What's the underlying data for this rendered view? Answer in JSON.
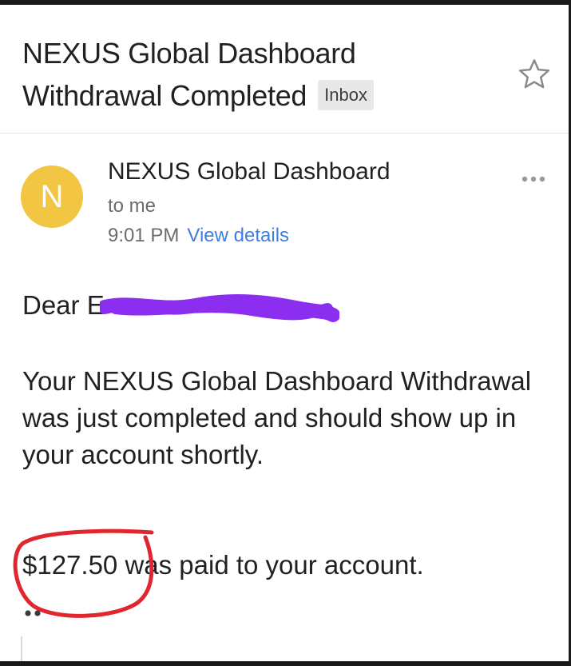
{
  "email": {
    "subject_line_1": "NEXUS Global Dashboard",
    "subject_line_2": "Withdrawal Completed",
    "label": "Inbox",
    "sender": {
      "avatar_letter": "N",
      "name": "NEXUS Global Dashboard",
      "recipient": "to me",
      "time": "9:01 PM",
      "details_link": "View details"
    },
    "body": {
      "greeting": "Dear E",
      "message": "Your NEXUS Global Dashboard Withdrawal was just completed and should show up in your  account shortly.",
      "paid_statement": "$127.50 was paid to your account."
    }
  },
  "colors": {
    "avatar": "#f2c543",
    "link": "#3d7fe0",
    "redaction": "#8b2ef0",
    "annotation_circle": "#e0262e"
  },
  "icons": {
    "star": "star-icon",
    "more": "more-horizontal-icon",
    "trimmed_content": "ellipsis-icon"
  }
}
